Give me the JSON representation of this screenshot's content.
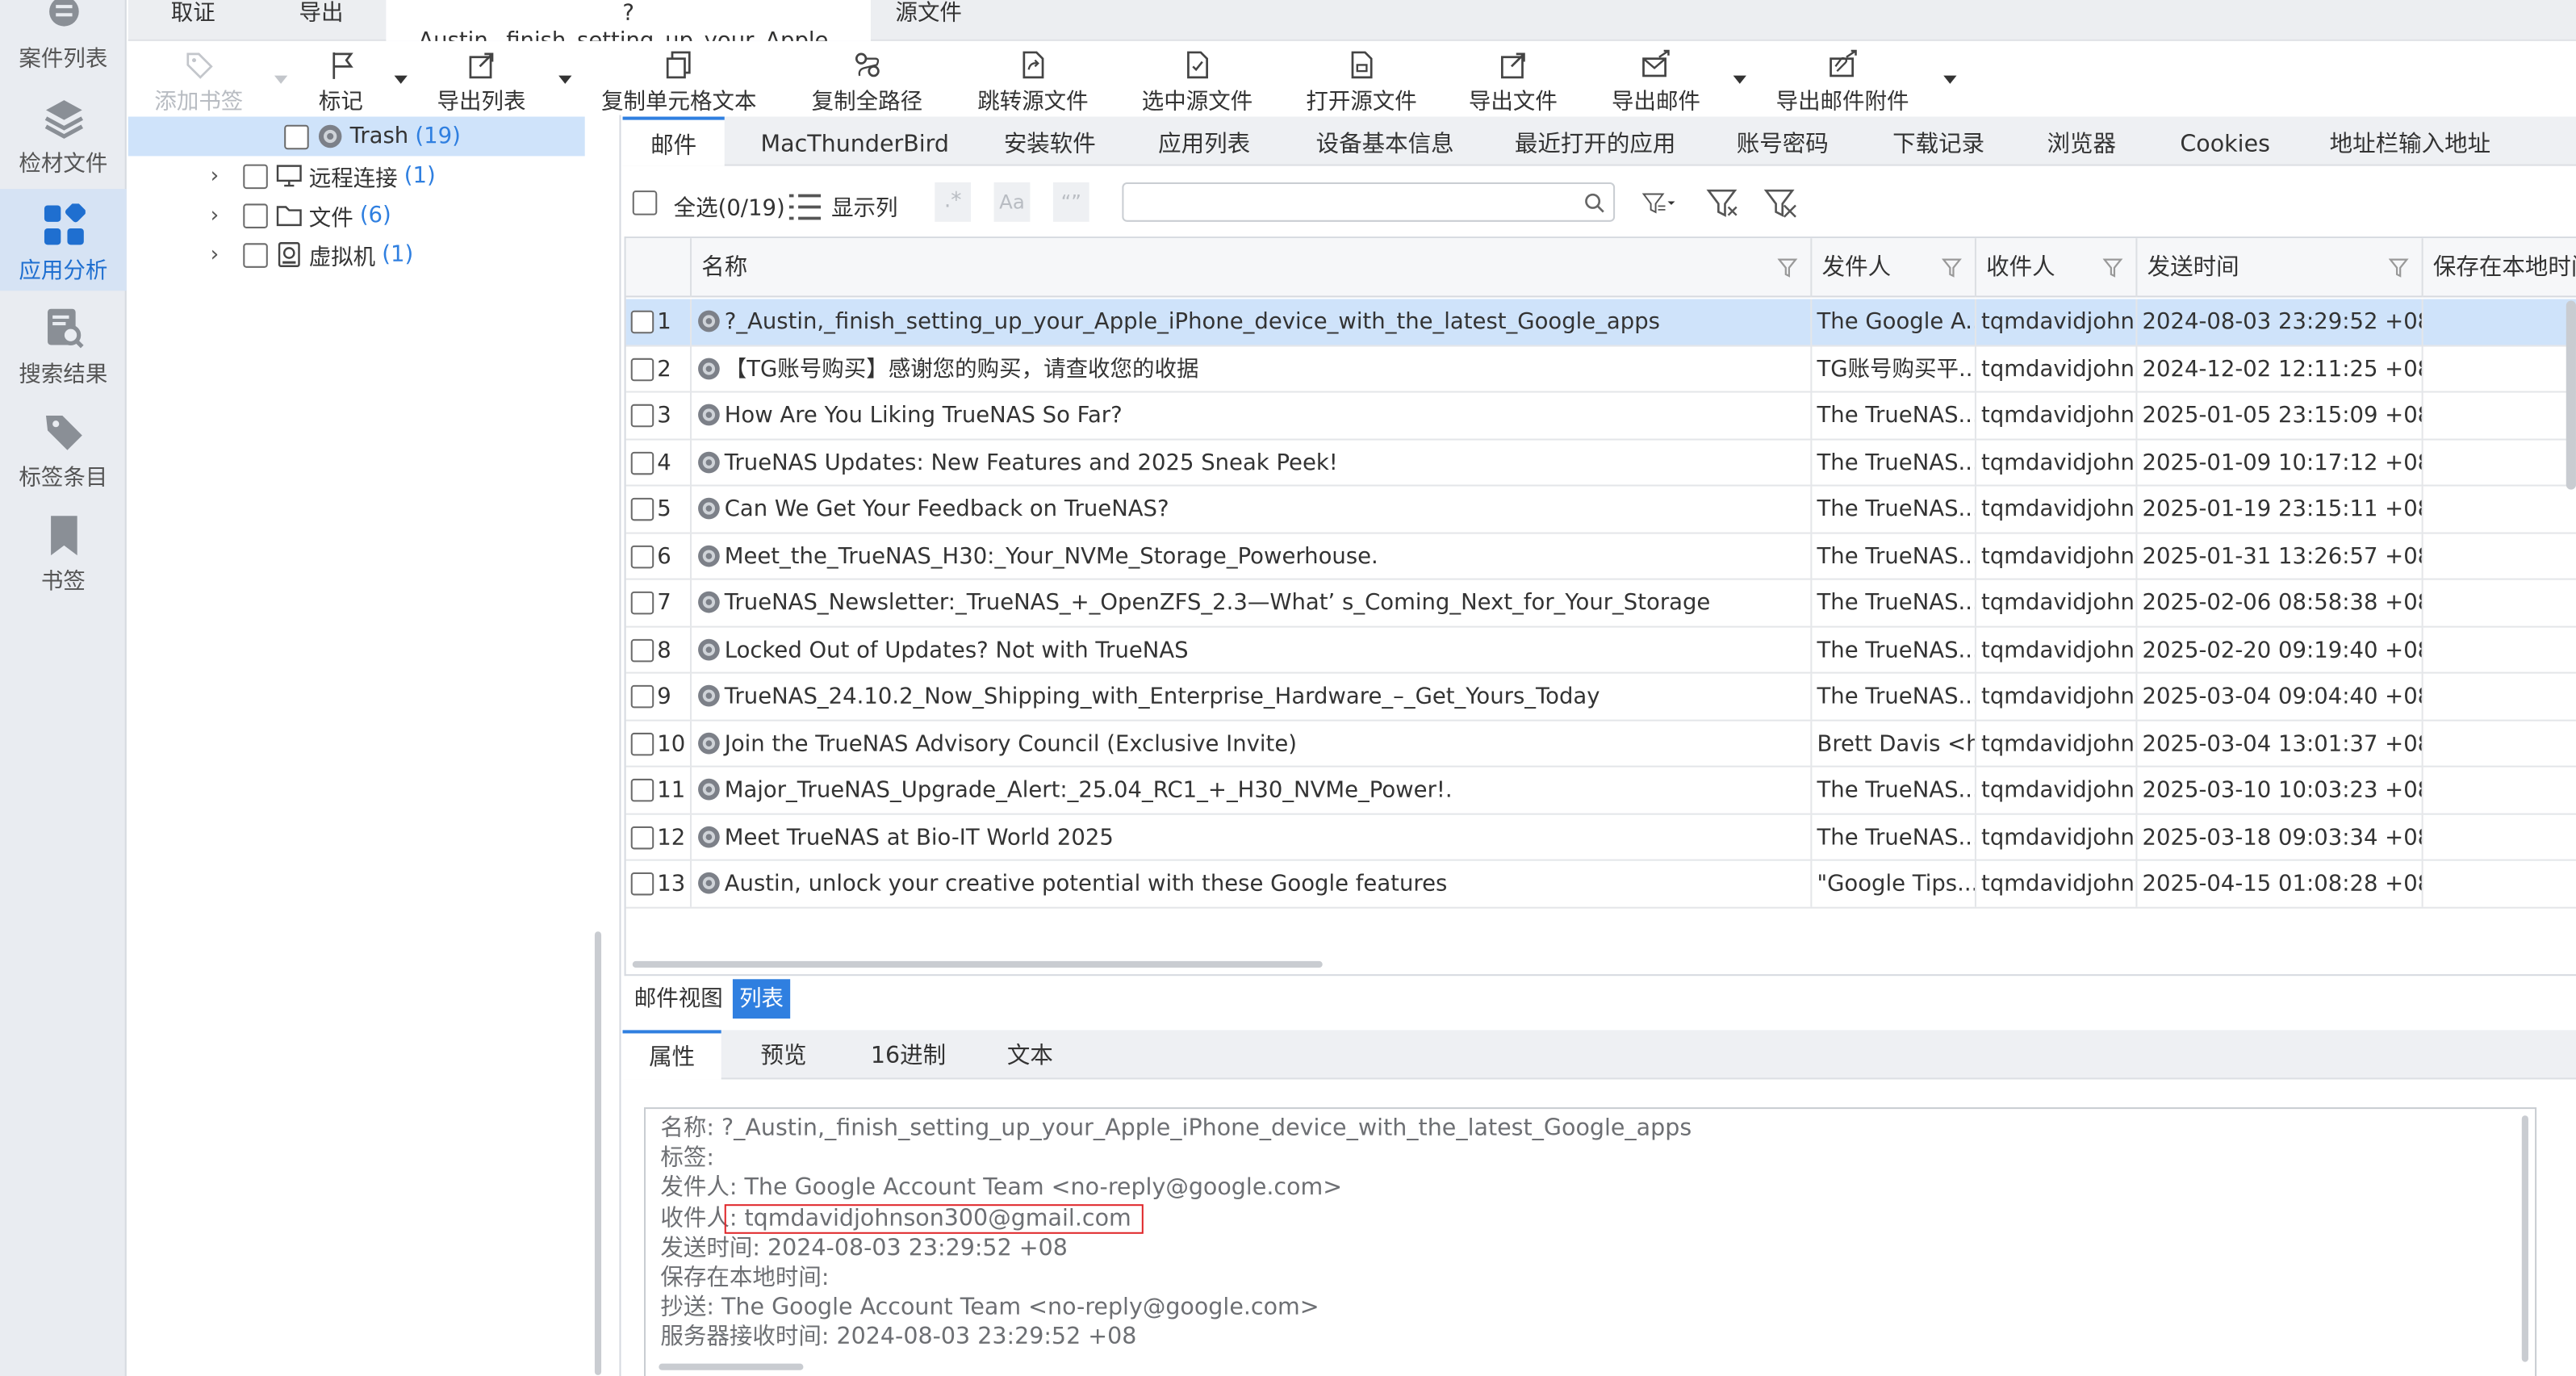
{
  "nav": {
    "items": [
      {
        "label": "案件列表",
        "icon": "case-list-icon"
      },
      {
        "label": "检材文件",
        "icon": "layers-icon"
      },
      {
        "label": "应用分析",
        "icon": "app-grid-icon",
        "active": true
      },
      {
        "label": "搜索结果",
        "icon": "search-result-icon"
      },
      {
        "label": "标签条目",
        "icon": "tag-icon"
      },
      {
        "label": "书签",
        "icon": "bookmark-icon"
      }
    ]
  },
  "top_tabs": [
    "取证",
    "导出",
    "?_Austin,_finish_setting_up_your_Apple...",
    "源文件"
  ],
  "toolbar": {
    "add_bookmark": "添加书签",
    "mark": "标记",
    "export_list": "导出列表",
    "copy_cell_text": "复制单元格文本",
    "copy_full_path": "复制全路径",
    "jump_source": "跳转源文件",
    "select_source": "选中源文件",
    "open_source": "打开源文件",
    "export_file": "导出文件",
    "export_mail": "导出邮件",
    "export_attachment": "导出邮件附件"
  },
  "tree": {
    "rows": [
      {
        "label": "Trash",
        "count": "(19)"
      },
      {
        "label": "远程连接",
        "count": "(1)"
      },
      {
        "label": "文件",
        "count": "(6)"
      },
      {
        "label": "虚拟机",
        "count": "(1)"
      }
    ]
  },
  "category_tabs": [
    "邮件",
    "MacThunderBird",
    "安装软件",
    "应用列表",
    "设备基本信息",
    "最近打开的应用",
    "账号密码",
    "下载记录",
    "浏览器",
    "Cookies",
    "地址栏输入地址"
  ],
  "filter": {
    "select_all": "全选(0/19)",
    "show_columns": "显示列",
    "regex_label": ".*",
    "case_label": "Aa",
    "quote_label": "“”",
    "search_value": "",
    "search_placeholder": ""
  },
  "grid": {
    "columns": [
      "名称",
      "发件人",
      "收件人",
      "发送时间",
      "保存在本地时间"
    ],
    "rows": [
      {
        "n": "1",
        "name": "?_Austin,_finish_setting_up_your_Apple_iPhone_device_with_the_latest_Google_apps",
        "from": "The Google A...",
        "to": "tqmdavidjohn...",
        "time": "2024-08-03 23:29:52 +08"
      },
      {
        "n": "2",
        "name": "【TG账号购买】感谢您的购买，请查收您的收据",
        "from": "TG账号购买平...",
        "to": "tqmdavidjohn...",
        "time": "2024-12-02 12:11:25 +08"
      },
      {
        "n": "3",
        "name": "How Are You Liking TrueNAS So Far?",
        "from": "The TrueNAS...",
        "to": "tqmdavidjohn...",
        "time": "2025-01-05 23:15:09 +08"
      },
      {
        "n": "4",
        "name": "TrueNAS Updates: New Features and 2025 Sneak Peek!",
        "from": "The TrueNAS...",
        "to": "tqmdavidjohn...",
        "time": "2025-01-09 10:17:12 +08"
      },
      {
        "n": "5",
        "name": "Can We Get Your Feedback on TrueNAS?",
        "from": "The TrueNAS...",
        "to": "tqmdavidjohn...",
        "time": "2025-01-19 23:15:11 +08"
      },
      {
        "n": "6",
        "name": "Meet_the_TrueNAS_H30:_Your_NVMe_Storage_Powerhouse.",
        "from": "The TrueNAS...",
        "to": "tqmdavidjohn...",
        "time": "2025-01-31 13:26:57 +08"
      },
      {
        "n": "7",
        "name": "TrueNAS_Newsletter:_TrueNAS_+_OpenZFS_2.3—What’ s_Coming_Next_for_Your_Storage",
        "from": "The TrueNAS...",
        "to": "tqmdavidjohn...",
        "time": "2025-02-06 08:58:38 +08"
      },
      {
        "n": "8",
        "name": "Locked Out of Updates? Not with TrueNAS",
        "from": "The TrueNAS...",
        "to": "tqmdavidjohn...",
        "time": "2025-02-20 09:19:40 +08"
      },
      {
        "n": "9",
        "name": "TrueNAS_24.10.2_Now_Shipping_with_Enterprise_Hardware_–_Get_Yours_Today",
        "from": "The TrueNAS...",
        "to": "tqmdavidjohn...",
        "time": "2025-03-04 09:04:40 +08"
      },
      {
        "n": "10",
        "name": "Join the TrueNAS Advisory Council (Exclusive Invite)",
        "from": "Brett Davis <h...",
        "to": "tqmdavidjohn...",
        "time": "2025-03-04 13:01:37 +08"
      },
      {
        "n": "11",
        "name": "Major_TrueNAS_Upgrade_Alert:_25.04_RC1_+_H30_NVMe_Power!.",
        "from": "The TrueNAS...",
        "to": "tqmdavidjohn...",
        "time": "2025-03-10 10:03:23 +08"
      },
      {
        "n": "12",
        "name": "Meet TrueNAS at Bio-IT World 2025",
        "from": "The TrueNAS...",
        "to": "tqmdavidjohn...",
        "time": "2025-03-18 09:03:34 +08"
      },
      {
        "n": "13",
        "name": "Austin, unlock your creative potential with these Google features",
        "from": "\"Google Tips...",
        "to": "tqmdavidjohn...",
        "time": "2025-04-15 01:08:28 +08"
      }
    ]
  },
  "view_switch": {
    "mail_view": "邮件视图",
    "list": "列表"
  },
  "detail_tabs": [
    "属性",
    "预览",
    "16进制",
    "文本"
  ],
  "props": {
    "lines": [
      "名称: ?_Austin,_finish_setting_up_your_Apple_iPhone_device_with_the_latest_Google_apps",
      "标签:",
      "发件人: The Google Account Team <no-reply@google.com>",
      "收件人: tqmdavidjohnson300@gmail.com",
      "发送时间: 2024-08-03 23:29:52 +08",
      "保存在本地时间:",
      "抄送: The Google Account Team <no-reply@google.com>",
      "服务器接收时间: 2024-08-03 23:29:52 +08"
    ]
  },
  "colors": {
    "accent": "#2f7fe0",
    "selection": "#cfe3fa",
    "highlight_box": "#e0272a"
  }
}
